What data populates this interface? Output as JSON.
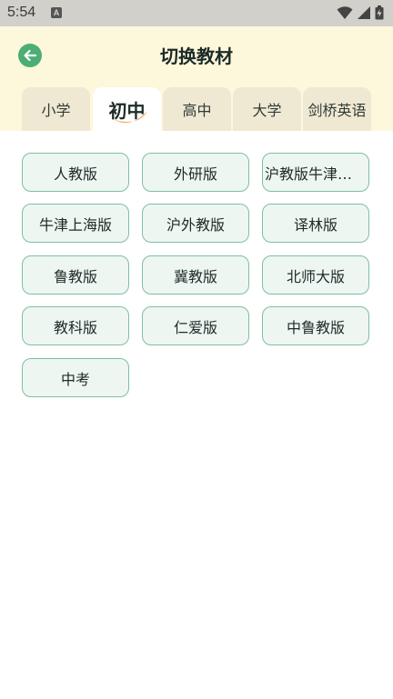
{
  "status_bar": {
    "time": "5:54",
    "notification_icon": "a-icon",
    "icons": [
      "wifi-icon",
      "signal-icon",
      "battery-icon"
    ]
  },
  "header": {
    "title": "切换教材",
    "back_icon": "arrow-left-icon"
  },
  "tabs": [
    {
      "label": "小学",
      "active": false
    },
    {
      "label": "初中",
      "active": true
    },
    {
      "label": "高中",
      "active": false
    },
    {
      "label": "大学",
      "active": false
    },
    {
      "label": "剑桥英语",
      "active": false
    }
  ],
  "textbooks": [
    {
      "label": "人教版"
    },
    {
      "label": "外研版"
    },
    {
      "label": "沪教版牛津上海版"
    },
    {
      "label": "牛津上海版"
    },
    {
      "label": "沪外教版"
    },
    {
      "label": "译林版"
    },
    {
      "label": "鲁教版"
    },
    {
      "label": "冀教版"
    },
    {
      "label": "北师大版"
    },
    {
      "label": "教科版"
    },
    {
      "label": "仁爱版"
    },
    {
      "label": "中鲁教版"
    },
    {
      "label": "中考"
    }
  ],
  "colors": {
    "header_bg": "#fdf7dc",
    "tab_bg": "#efe8d3",
    "accent_green": "#4cae75",
    "button_border": "#7fbfa1",
    "button_bg": "#eef6f2",
    "active_swoosh": "#f3a85a"
  }
}
